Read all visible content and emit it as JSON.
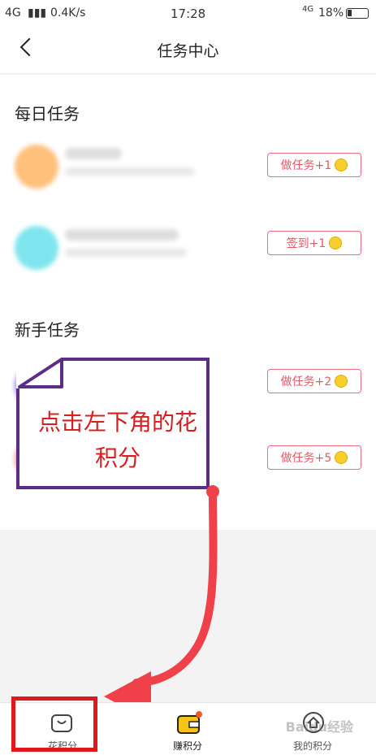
{
  "status_bar": {
    "network": "4G",
    "speed": "0.4K/s",
    "time": "17:28",
    "network_right": "4G",
    "battery": "18%"
  },
  "nav": {
    "title": "任务中心"
  },
  "daily": {
    "title": "每日任务",
    "tasks": [
      {
        "button": "做任务+1",
        "avatar_color": "#ffc07a"
      },
      {
        "button": "签到+1",
        "avatar_color": "#7ee5ee"
      }
    ]
  },
  "newbie": {
    "title": "新手任务",
    "tasks": [
      {
        "button": "做任务+2",
        "avatar_color": "#9b88ff"
      },
      {
        "button": "做任务+5",
        "avatar_color": "#ff9b9b"
      }
    ]
  },
  "annotation": {
    "text": "点击左下角的花积分"
  },
  "tabbar": {
    "items": [
      {
        "label": "花积分",
        "icon": "bag-icon"
      },
      {
        "label": "赚积分",
        "icon": "wallet-icon"
      },
      {
        "label": "我的积分",
        "icon": "home-icon"
      }
    ]
  },
  "watermark": "Baidu经验",
  "colors": {
    "accent": "#e25866",
    "coin": "#f7cf2a",
    "annotation_red": "#d42020",
    "annotation_border": "#5d2d86"
  }
}
